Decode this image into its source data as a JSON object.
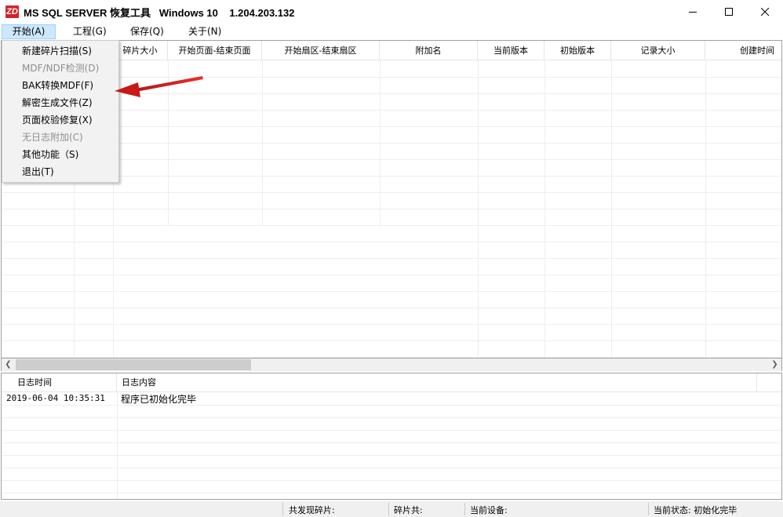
{
  "window": {
    "logo_text": "ZD",
    "title": "MS SQL SERVER 恢复工具   Windows 10    1.204.203.132"
  },
  "menubar": [
    {
      "label": "开始(A)"
    },
    {
      "label": "工程(G)"
    },
    {
      "label": "保存(Q)"
    },
    {
      "label": "关于(N)"
    }
  ],
  "grid": {
    "columns": [
      "碎片大小",
      "开始页面-结束页面",
      "开始扇区-结束扇区",
      "附加名",
      "当前版本",
      "初始版本",
      "记录大小",
      "创建时间"
    ]
  },
  "start_menu": {
    "items": [
      {
        "label": "新建碎片扫描(S)",
        "enabled": true
      },
      {
        "label": "MDF/NDF检测(D)",
        "enabled": false
      },
      {
        "label": "BAK转换MDF(F)",
        "enabled": true
      },
      {
        "label": "解密生成文件(Z)",
        "enabled": true
      },
      {
        "label": "页面校验修复(X)",
        "enabled": true
      },
      {
        "label": "无日志附加(C)",
        "enabled": false
      },
      {
        "label": "其他功能（S)",
        "enabled": true
      },
      {
        "label": "退出(T)",
        "enabled": true
      }
    ]
  },
  "log": {
    "columns": [
      "日志时间",
      "日志内容"
    ],
    "rows": [
      {
        "time": "2019-06-04 10:35:31",
        "message": "程序已初始化完毕"
      }
    ]
  },
  "statusbar": {
    "fragments_found": "共发现碎片:",
    "fragments_total": "碎片共:",
    "current_device": "当前设备:",
    "current_status": "当前状态: 初始化完毕"
  },
  "colors": {
    "menu_active_bg": "#cce8ff",
    "arrow": "#d8202a"
  }
}
